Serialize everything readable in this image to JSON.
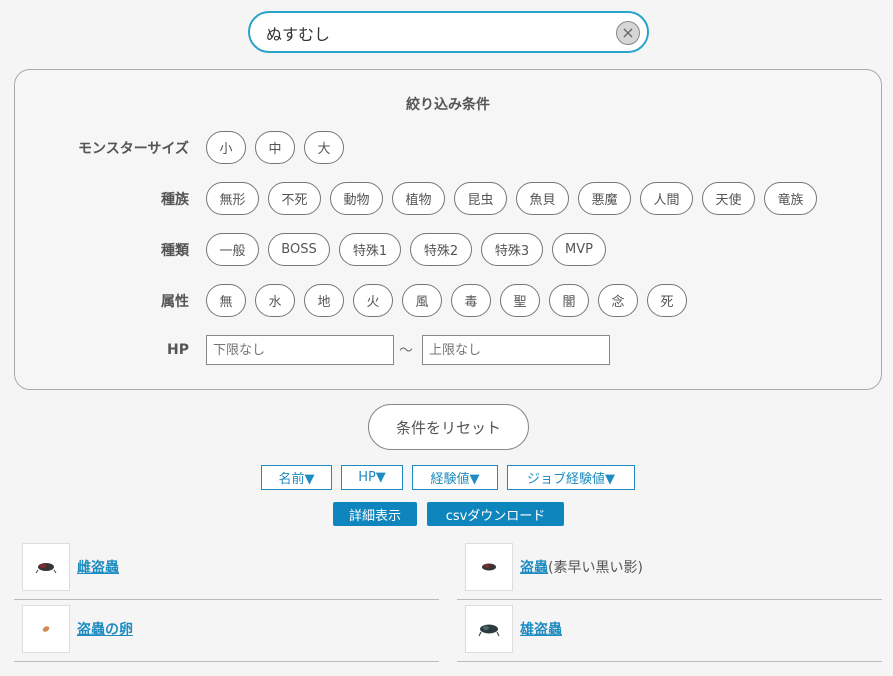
{
  "search": {
    "value": "ぬすむし",
    "clear_icon": "×"
  },
  "filter": {
    "title": "絞り込み条件",
    "size": {
      "label": "モンスターサイズ",
      "options": [
        "小",
        "中",
        "大"
      ]
    },
    "race": {
      "label": "種族",
      "options": [
        "無形",
        "不死",
        "動物",
        "植物",
        "昆虫",
        "魚貝",
        "悪魔",
        "人間",
        "天使",
        "竜族"
      ]
    },
    "type": {
      "label": "種類",
      "options": [
        "一般",
        "BOSS",
        "特殊1",
        "特殊2",
        "特殊3",
        "MVP"
      ]
    },
    "element": {
      "label": "属性",
      "options": [
        "無",
        "水",
        "地",
        "火",
        "風",
        "毒",
        "聖",
        "闇",
        "念",
        "死"
      ]
    },
    "hp": {
      "label": "HP",
      "min_placeholder": "下限なし",
      "max_placeholder": "上限なし",
      "separator": "～"
    }
  },
  "reset_label": "条件をリセット",
  "sort": [
    "名前▼",
    "HP▼",
    "経験値▼",
    "ジョブ経験値▼"
  ],
  "actions": {
    "detail": "詳細表示",
    "csv": "csvダウンロード"
  },
  "results": [
    {
      "name": "雌盗蟲",
      "extra": ""
    },
    {
      "name": "盗蟲",
      "extra": "(素早い黒い影)"
    },
    {
      "name": "盗蟲の卵",
      "extra": ""
    },
    {
      "name": "雄盗蟲",
      "extra": ""
    }
  ]
}
